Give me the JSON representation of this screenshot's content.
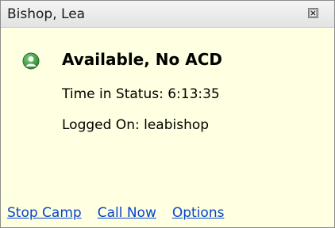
{
  "window": {
    "title": "Bishop, Lea",
    "close_icon": "close-box-icon"
  },
  "status": {
    "icon": "available-user-icon",
    "icon_color": "#3a9a3a",
    "label": "Available, No ACD"
  },
  "details": {
    "time_in_status": "Time in Status: 6:13:35",
    "logged_on": "Logged On: leabishop"
  },
  "actions": {
    "stop_camp": "Stop Camp",
    "call_now": "Call Now",
    "options": "Options"
  },
  "colors": {
    "background": "#ffffe1",
    "link": "#0645cc"
  }
}
